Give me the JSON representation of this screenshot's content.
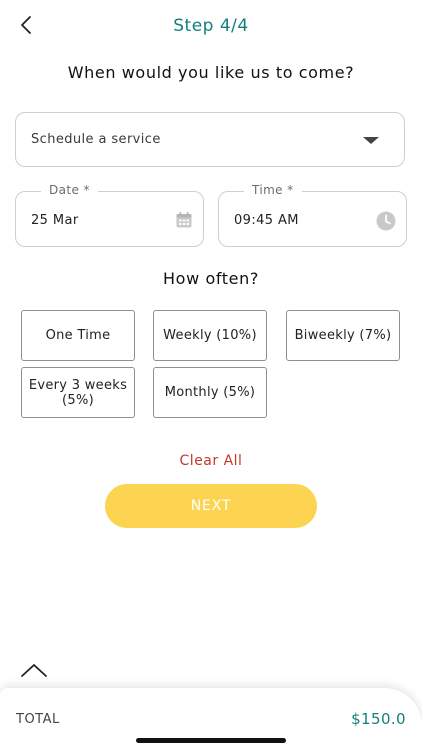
{
  "header": {
    "step_label": "Step 4/4",
    "back_icon": "chevron-left-icon"
  },
  "schedule": {
    "question": "When would you like us to come?",
    "service_select": {
      "value": "Schedule a service",
      "icon": "caret-down-icon"
    },
    "date": {
      "label": "Date *",
      "value": "25 Mar",
      "icon": "calendar-icon"
    },
    "time": {
      "label": "Time *",
      "value": "09:45 AM",
      "icon": "clock-icon"
    }
  },
  "frequency": {
    "title": "How often?",
    "options": [
      {
        "label": "One Time"
      },
      {
        "label": "Weekly (10%)"
      },
      {
        "label": "Biweekly (7%)"
      },
      {
        "label": "Every 3 weeks (5%)"
      },
      {
        "label": "Monthly (5%)"
      }
    ]
  },
  "actions": {
    "clear_all": "Clear All",
    "next": "NEXT"
  },
  "footer": {
    "collapse_icon": "chevron-up-icon",
    "total_label": "TOTAL",
    "total_value": "$150.0"
  },
  "colors": {
    "accent": "#127f7c",
    "next_button": "#fcd452",
    "clear_all": "#c0392b"
  }
}
